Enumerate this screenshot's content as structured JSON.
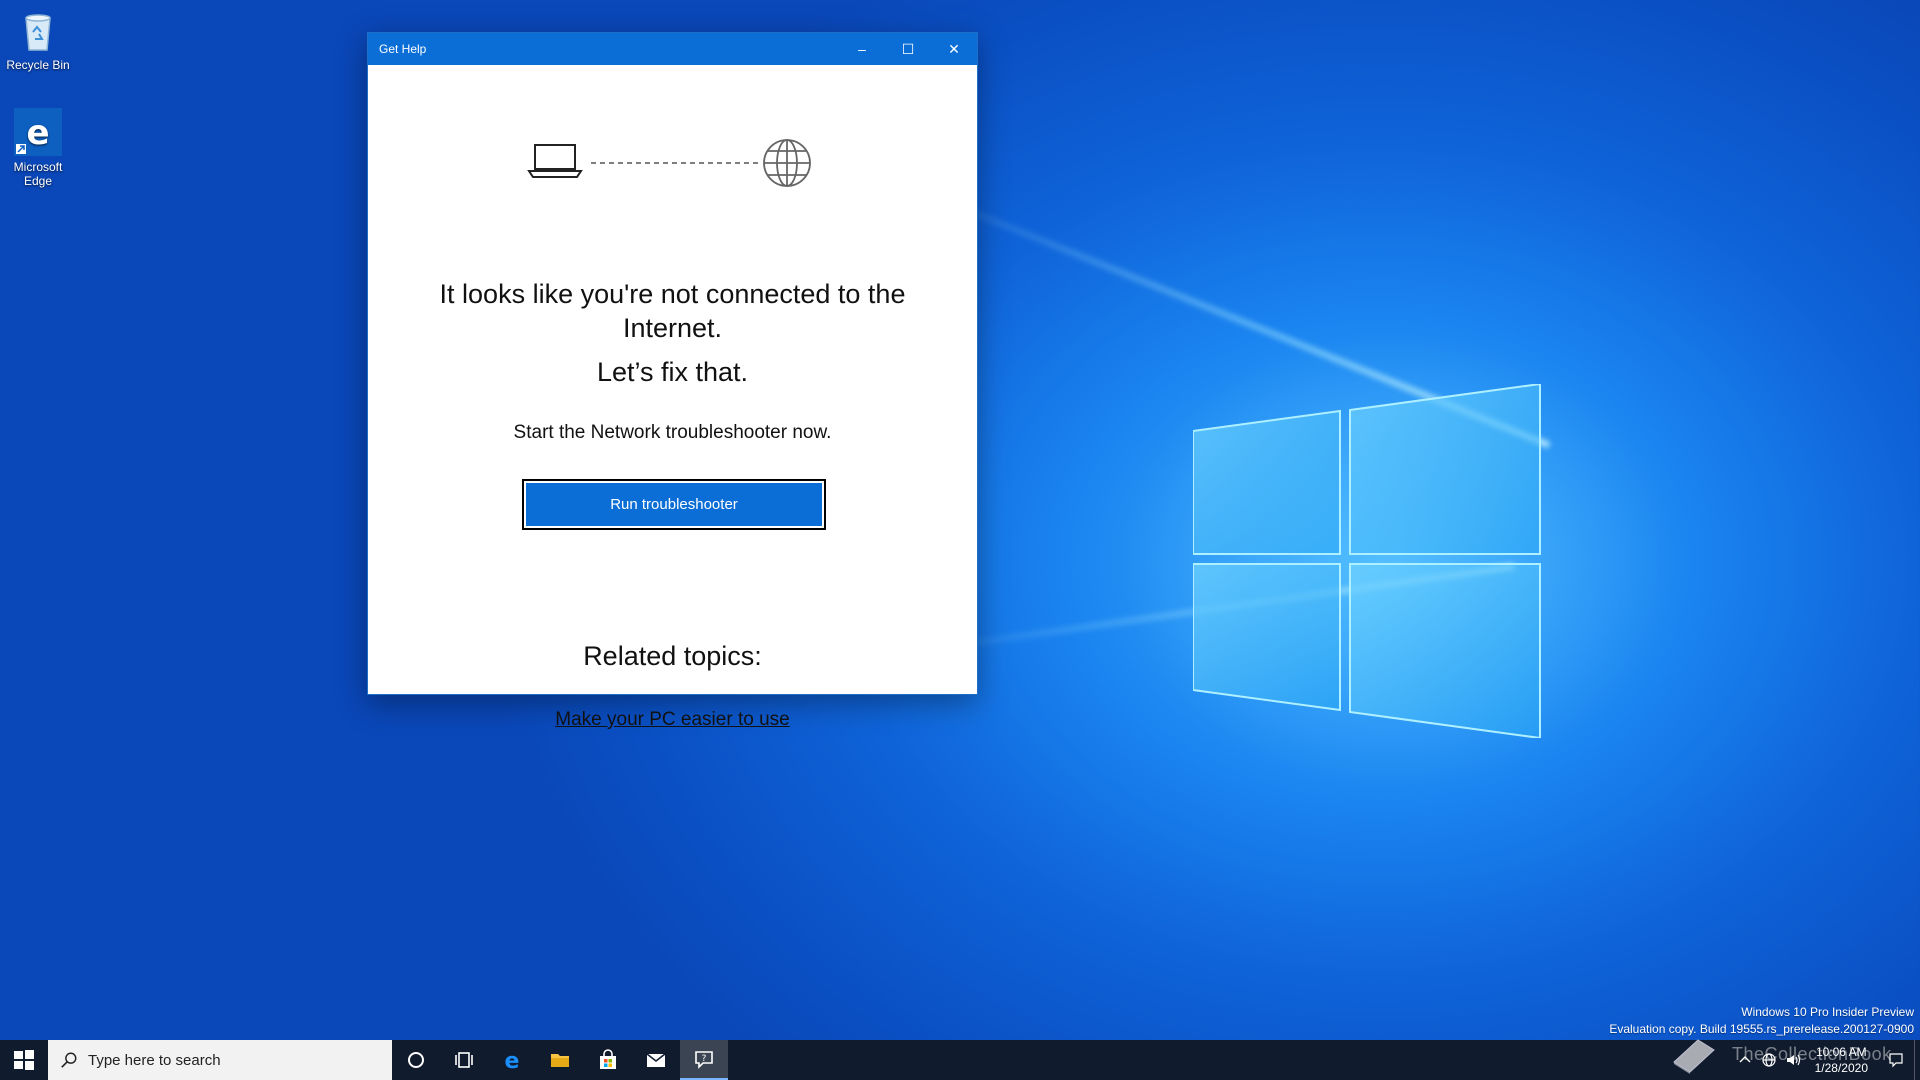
{
  "desktop": {
    "icons": [
      {
        "label": "Recycle Bin"
      },
      {
        "label": "Microsoft Edge"
      }
    ]
  },
  "window": {
    "title": "Get Help",
    "controls": {
      "minimize": "–",
      "maximize": "☐",
      "close": "✕"
    },
    "heading": "It looks like you're not connected to the Internet.",
    "subheading": "Let’s fix that.",
    "body": "Start the Network troubleshooter now.",
    "button_label": "Run troubleshooter",
    "related_heading": "Related topics:",
    "related_link": "Make your PC easier to use"
  },
  "watermark": {
    "line1": "Windows 10 Pro Insider Preview",
    "line2": "Evaluation copy. Build 19555.rs_prerelease.200127-0900"
  },
  "taskbar": {
    "search_placeholder": "Type here to search",
    "clock_time": "10:06 AM",
    "clock_date": "1/28/2020",
    "overlay_text": "TheCollectionBook"
  },
  "colors": {
    "accent": "#0a6ed6",
    "taskbar": "#101b2d"
  }
}
